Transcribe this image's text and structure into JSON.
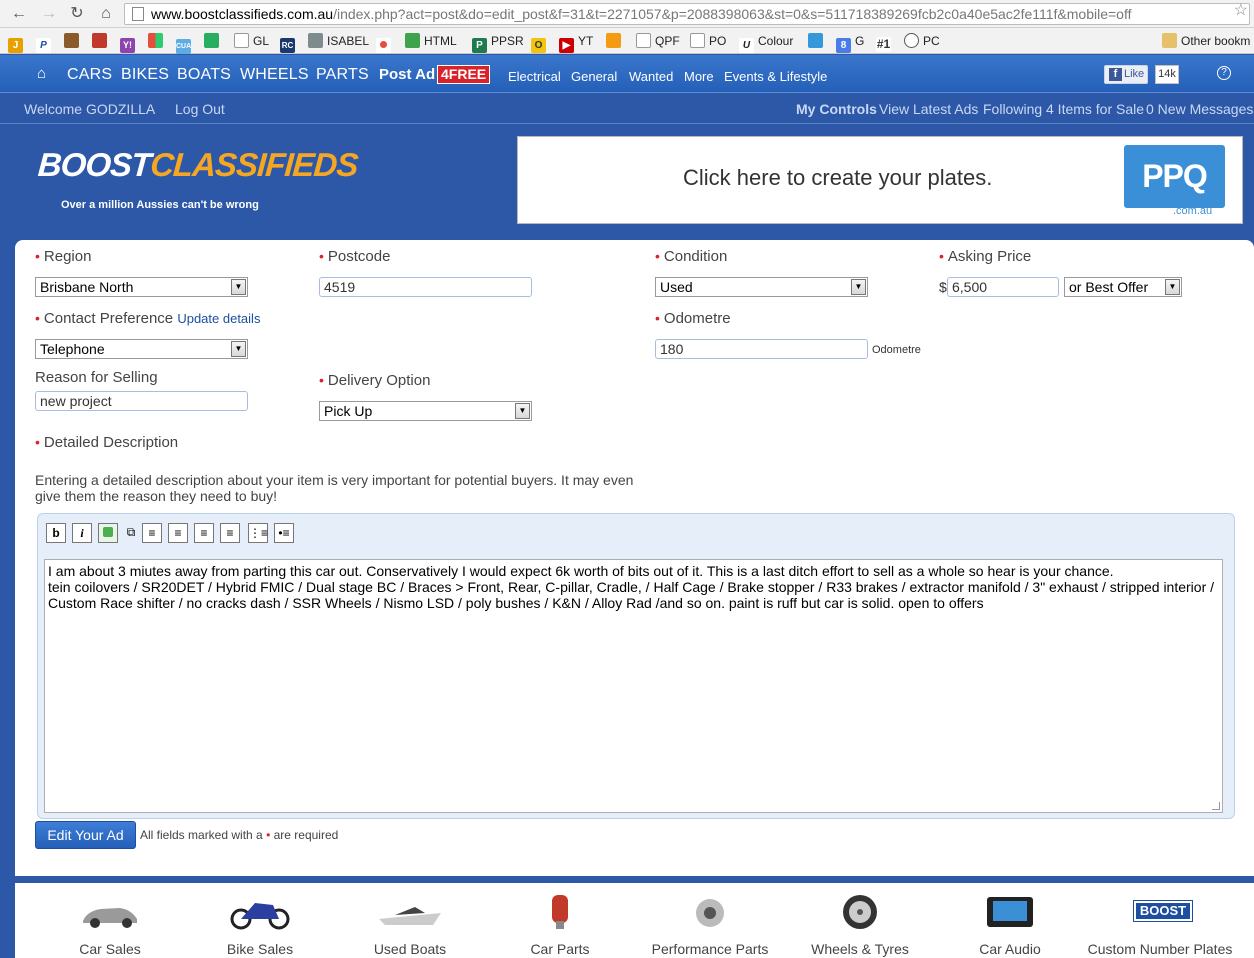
{
  "browser": {
    "url_domain": "www.boostclassifieds.com.au",
    "url_path": "/index.php?act=post&do=edit_post&f=31&t=2271057&p=2088398063&st=0&s=511718389269fcb2c0a40e5ac2fe111f&mobile=off",
    "bookmarks": [
      {
        "label": "",
        "color": "#e8a000"
      },
      {
        "label": "",
        "color": "#1e4ea0"
      },
      {
        "label": "",
        "color": "#8b5a2b"
      },
      {
        "label": "",
        "color": "#c0392b"
      },
      {
        "label": "",
        "color": "#8e44ad"
      },
      {
        "label": "",
        "color": "#2ecc71"
      },
      {
        "label": "",
        "color": "#5dade2"
      },
      {
        "label": "",
        "color": "#27ae60"
      },
      {
        "label": "GL",
        "color": "#ffffff"
      },
      {
        "label": "",
        "color": "#1a3a6e"
      },
      {
        "label": "ISABEL",
        "color": "#7f8c8d"
      },
      {
        "label": "",
        "color": "#e74c3c"
      },
      {
        "label": "HTML",
        "color": "#3fa34d"
      },
      {
        "label": "PPSR",
        "color": "#1f7a4d"
      },
      {
        "label": "",
        "color": "#f1c40f"
      },
      {
        "label": "YT",
        "color": "#cc0000"
      },
      {
        "label": "",
        "color": "#f39c12"
      },
      {
        "label": "QPF",
        "color": "#ffffff"
      },
      {
        "label": "PO",
        "color": "#ffffff"
      },
      {
        "label": "Colour",
        "color": "#222222"
      },
      {
        "label": "",
        "color": "#3498db"
      },
      {
        "label": "G",
        "color": "#4a7de8"
      },
      {
        "label": "",
        "color": "#333333"
      },
      {
        "label": "PC",
        "color": "#555555"
      }
    ],
    "other_bookmarks": "Other bookm"
  },
  "topnav": {
    "main": [
      "CARS",
      "BIKES",
      "BOATS",
      "WHEELS",
      "PARTS"
    ],
    "post_ad": "Post Ad",
    "free_badge": "4FREE",
    "secondary": [
      "Electrical",
      "General",
      "Wanted",
      "More",
      "Events & Lifestyle"
    ],
    "fb_like": "Like",
    "fb_count": "14k",
    "help": "?"
  },
  "subnav": {
    "welcome": "Welcome GODZILLA",
    "logout": "Log Out",
    "my_controls": "My Controls",
    "view_latest": "View Latest Ads",
    "following": "Following",
    "items_for_sale": "4 Items for Sale",
    "messages": "0 New Messages"
  },
  "brand": {
    "logo_boost": "BOOST",
    "logo_classifieds": "CLASSIFIEDS",
    "tagline": "Over a million Aussies can't be wrong"
  },
  "ad": {
    "text": "Click here to create your plates.",
    "logo": "PPQ",
    "logo_sub": ".com.au"
  },
  "form": {
    "region": {
      "label": "Region",
      "value": "Brisbane North"
    },
    "postcode": {
      "label": "Postcode",
      "value": "4519"
    },
    "condition": {
      "label": "Condition",
      "value": "Used"
    },
    "asking_price": {
      "label": "Asking Price",
      "currency": "$",
      "value": "6,500",
      "offer": "or Best Offer"
    },
    "contact": {
      "label": "Contact Preference",
      "update_link": "Update details",
      "value": "Telephone"
    },
    "odometer": {
      "label": "Odometre",
      "value": "180",
      "unit": "Odometre"
    },
    "reason": {
      "label": "Reason for Selling",
      "value": "new project"
    },
    "delivery": {
      "label": "Delivery Option",
      "value": "Pick Up"
    },
    "description": {
      "label": "Detailed Description",
      "intro": "Entering a detailed description about your item is very important for potential buyers. It may even give them the reason they need to buy!",
      "text_line1": "I am about 3 miutes away from parting this car out. Conservatively I would expect 6k worth of bits out of it. This is a last ditch effort to sell as a whole so hear is your chance.",
      "text_line2": "tein coilovers / SR20DET / Hybrid FMIC / Dual stage BC / Braces > Front, Rear, C-pillar, Cradle, / Half Cage / Brake stopper / R33 brakes / extractor manifold / 3\" exhaust / stripped interior / Custom Race shifter / no cracks dash / SSR Wheels / Nismo LSD / poly bushes / K&N / Alloy Rad /and so on. paint is ruff but car is solid. open to offers"
    },
    "toolbar": [
      "b",
      "i"
    ],
    "submit": "Edit Your Ad",
    "required_note_pre": "All fields marked with a",
    "required_note_post": "are required"
  },
  "footer": {
    "categories": [
      "Car Sales",
      "Bike Sales",
      "Used Boats",
      "Car Parts",
      "Performance Parts",
      "Wheels & Tyres",
      "Car Audio",
      "Custom Number Plates"
    ],
    "plate_badge": "BOOST"
  }
}
